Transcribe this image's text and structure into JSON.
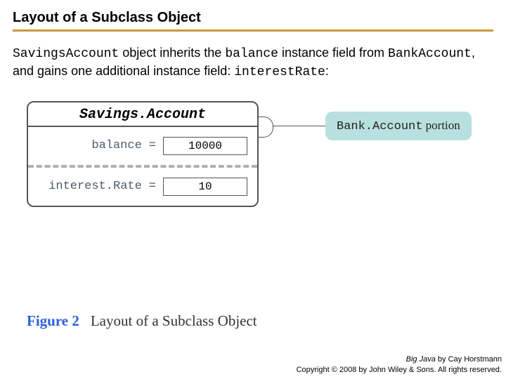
{
  "title": "Layout of a Subclass Object",
  "intro": {
    "code1": "SavingsAccount",
    "t1": " object inherits the ",
    "code2": "balance",
    "t2": " instance field from ",
    "code3": "BankAccount",
    "t3": ", and gains one additional instance field: ",
    "code4": "interestRate",
    "t4": ":"
  },
  "diagram": {
    "className": "Savings.Account",
    "fields": [
      {
        "name": "balance",
        "value": "10000"
      },
      {
        "name": "interest.Rate",
        "value": "10"
      }
    ],
    "callout": {
      "code": "Bank.Account",
      "rest": " portion"
    }
  },
  "figure": {
    "label": "Figure 2",
    "caption": "Layout of a Subclass Object"
  },
  "footer": {
    "book": "Big Java",
    "by": " by Cay Horstmann",
    "copyright": "Copyright © 2008 by John Wiley & Sons. All rights reserved."
  }
}
